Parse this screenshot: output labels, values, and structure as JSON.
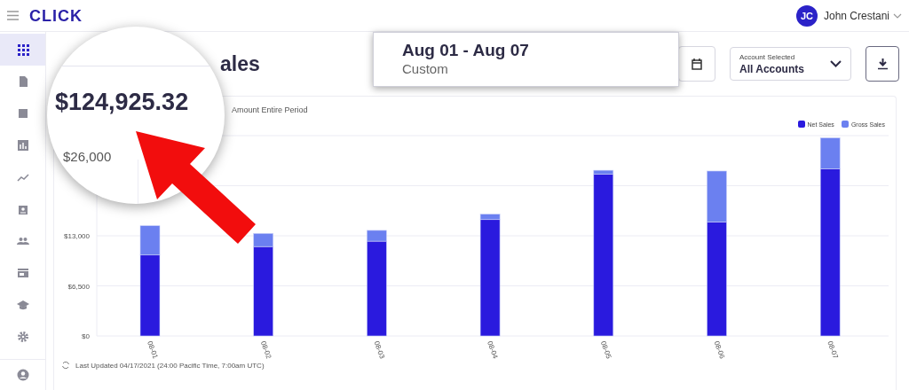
{
  "header": {
    "logo": "CLICK",
    "user": {
      "initials": "JC",
      "name": "John Crestani"
    }
  },
  "sidebar": {
    "items": [
      {
        "selected": true
      },
      {
        "selected": false
      },
      {
        "selected": false
      },
      {
        "selected": false
      },
      {
        "selected": false
      },
      {
        "selected": false
      },
      {
        "selected": false
      },
      {
        "selected": false
      },
      {
        "selected": false
      },
      {
        "selected": false
      },
      {
        "selected": false
      }
    ]
  },
  "page": {
    "title": "ales"
  },
  "toolbar": {
    "account_select": {
      "label": "Account Selected",
      "value": "All Accounts"
    }
  },
  "card": {
    "subtitle": "Amount Entire Period",
    "chart_data": {
      "type": "bar",
      "stacked": true,
      "categories": [
        "08-01",
        "08-02",
        "08-03",
        "08-04",
        "08-05",
        "08-06",
        "08-07"
      ],
      "ylim": [
        0,
        26000
      ],
      "yticks": [
        {
          "value": 0,
          "label": "$0"
        },
        {
          "value": 6500,
          "label": "$6,500"
        },
        {
          "value": 13000,
          "label": "$13,000"
        }
      ],
      "series": [
        {
          "name": "Net Sales",
          "color": "#2a1ade",
          "values": [
            10500,
            11600,
            12300,
            15100,
            21000,
            14800,
            21700
          ]
        },
        {
          "name": "Gross Sales",
          "color": "#6b80f0",
          "values": [
            3800,
            1700,
            1400,
            700,
            500,
            6600,
            4000
          ]
        }
      ]
    },
    "footer": "Last Updated 04/17/2021 (24:00 Pacific Time, 7:00am UTC)"
  },
  "magnifier": {
    "amount": "$124,925.32",
    "axis_label": "$26,000"
  },
  "date_popup": {
    "range": "Aug 01 - Aug 07",
    "preset": "Custom"
  }
}
